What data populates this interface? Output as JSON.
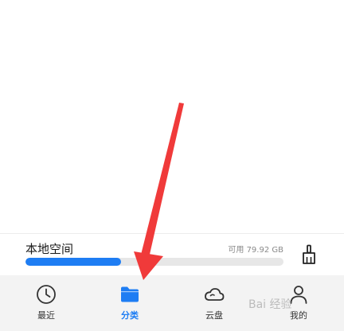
{
  "storage": {
    "title": "本地空间",
    "free_text": "可用 79.92 GB",
    "used_fraction": 0.37
  },
  "tabs": [
    {
      "label": "最近",
      "icon": "clock-icon",
      "active": false
    },
    {
      "label": "分类",
      "icon": "folder-icon",
      "active": true
    },
    {
      "label": "云盘",
      "icon": "cloud-icon",
      "active": false
    },
    {
      "label": "我的",
      "icon": "person-icon",
      "active": false
    }
  ],
  "watermark": {
    "text": "Bai 经验"
  },
  "colors": {
    "accent": "#1e7df3",
    "arrow": "#f03a3a",
    "tab_bar_bg": "#f3f3f3"
  }
}
